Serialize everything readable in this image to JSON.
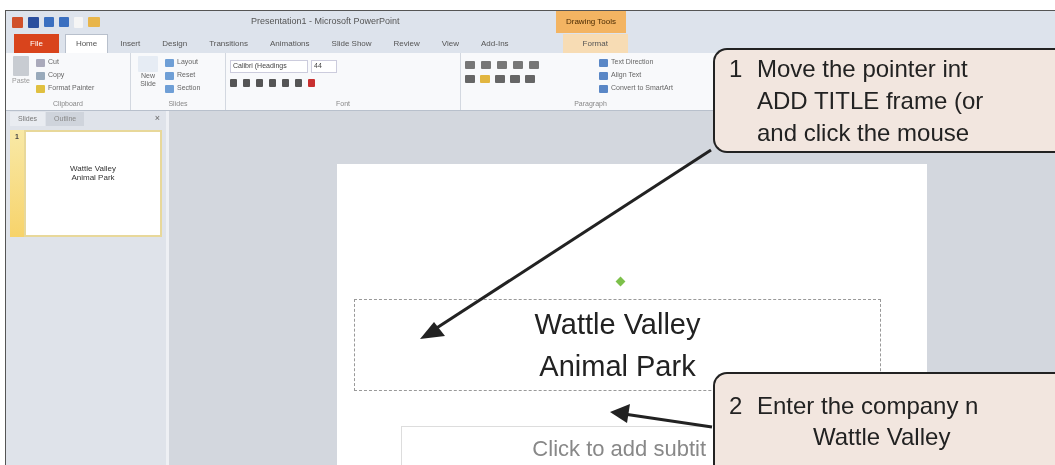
{
  "window": {
    "title": "Presentation1 - Microsoft PowerPoint",
    "contextual_tab": "Drawing Tools"
  },
  "tabs": [
    {
      "label": "File",
      "kind": "file",
      "selected": false
    },
    {
      "label": "Home",
      "kind": "normal",
      "selected": true
    },
    {
      "label": "Insert",
      "kind": "normal",
      "selected": false
    },
    {
      "label": "Design",
      "kind": "normal",
      "selected": false
    },
    {
      "label": "Transitions",
      "kind": "normal",
      "selected": false
    },
    {
      "label": "Animations",
      "kind": "normal",
      "selected": false
    },
    {
      "label": "Slide Show",
      "kind": "normal",
      "selected": false
    },
    {
      "label": "Review",
      "kind": "normal",
      "selected": false
    },
    {
      "label": "View",
      "kind": "normal",
      "selected": false
    },
    {
      "label": "Add-Ins",
      "kind": "normal",
      "selected": false
    },
    {
      "label": "Format",
      "kind": "contextual",
      "selected": false
    }
  ],
  "ribbon": {
    "clipboard": {
      "name": "Clipboard",
      "paste": "Paste",
      "items": [
        "Cut",
        "Copy",
        "Format Painter"
      ]
    },
    "slides": {
      "name": "Slides",
      "new_slide": [
        "New",
        "Slide"
      ],
      "items": [
        "Layout",
        "Reset",
        "Section"
      ]
    },
    "font": {
      "name": "Font",
      "font_name": "Calibri (Headings",
      "font_size": "44"
    },
    "paragraph": {
      "name": "Paragraph",
      "items": [
        "Text Direction",
        "Align Text",
        "Convert to SmartArt"
      ]
    }
  },
  "panel_tabs": [
    {
      "label": "Slides",
      "selected": true
    },
    {
      "label": "Outline",
      "selected": false
    }
  ],
  "panel_close": "×",
  "thumbnails": [
    {
      "number": "1",
      "selected": true,
      "lines": [
        "Wattle Valley",
        "Animal Park"
      ]
    }
  ],
  "slide": {
    "title_lines": [
      "Wattle Valley",
      "Animal Park"
    ],
    "subtitle_placeholder": "Click to add subtit"
  },
  "callouts": [
    {
      "number": "1",
      "lines": [
        "Move the pointer int",
        "ADD TITLE frame (or",
        "and click the mouse"
      ]
    },
    {
      "number": "2",
      "lines": [
        "Enter the company n"
      ],
      "example": "Wattle Valley"
    }
  ]
}
